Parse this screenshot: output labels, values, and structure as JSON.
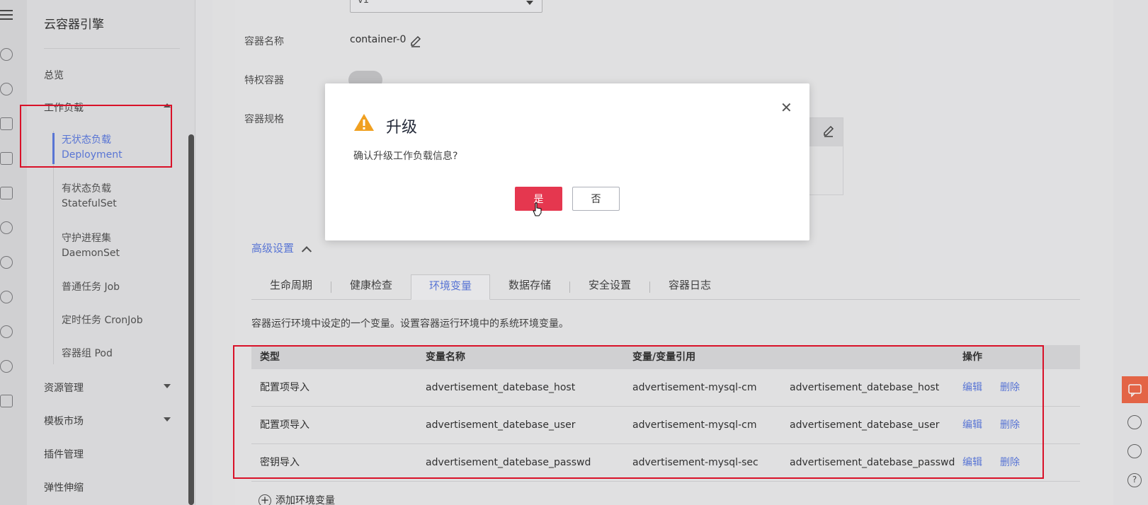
{
  "app": {
    "title": "云容器引擎"
  },
  "sidebar": {
    "items": [
      {
        "label": "总览"
      },
      {
        "label": "工作负载"
      },
      {
        "label": "资源管理"
      },
      {
        "label": "模板市场"
      },
      {
        "label": "插件管理"
      },
      {
        "label": "弹性伸缩"
      }
    ],
    "workload_sub": [
      {
        "cn": "无状态负载",
        "en": "Deployment",
        "active": true
      },
      {
        "cn": "有状态负载",
        "en": "StatefulSet"
      },
      {
        "cn": "守护进程集",
        "en": "DaemonSet"
      },
      {
        "cn": "普通任务 Job",
        "en": ""
      },
      {
        "cn": "定时任务 CronJob",
        "en": ""
      },
      {
        "cn": "容器组 Pod",
        "en": ""
      }
    ]
  },
  "form": {
    "version_value": "v1",
    "container_name_label": "容器名称",
    "container_name_value": "container-0",
    "privileged_label": "特权容器",
    "spec_label": "容器规格"
  },
  "advanced": {
    "label": "高级设置",
    "tabs": [
      "生命周期",
      "健康检查",
      "环境变量",
      "数据存储",
      "安全设置",
      "容器日志"
    ],
    "active_tab": "环境变量",
    "desc": "容器运行环境中设定的一个变量。设置容器运行环境中的系统环境变量。"
  },
  "env_table": {
    "headers": [
      "类型",
      "变量名称",
      "变量/变量引用",
      "",
      "操作"
    ],
    "rows": [
      {
        "type": "配置项导入",
        "name": "advertisement_datebase_host",
        "ref": "advertisement-mysql-cm",
        "key": "advertisement_datebase_host",
        "edit": "编辑",
        "del": "删除"
      },
      {
        "type": "配置项导入",
        "name": "advertisement_datebase_user",
        "ref": "advertisement-mysql-cm",
        "key": "advertisement_datebase_user",
        "edit": "编辑",
        "del": "删除"
      },
      {
        "type": "密钥导入",
        "name": "advertisement_datebase_passwd",
        "ref": "advertisement-mysql-sec",
        "key": "advertisement_datebase_passwd",
        "edit": "编辑",
        "del": "删除"
      }
    ],
    "add_label": "添加环境变量"
  },
  "dialog": {
    "title": "升级",
    "message": "确认升级工作负载信息?",
    "yes": "是",
    "no": "否",
    "icon": "warning-icon"
  },
  "colors": {
    "accent": "#5e7ce0",
    "danger": "#e5374f",
    "highlight": "#e5122b",
    "warning": "#f0a020"
  }
}
